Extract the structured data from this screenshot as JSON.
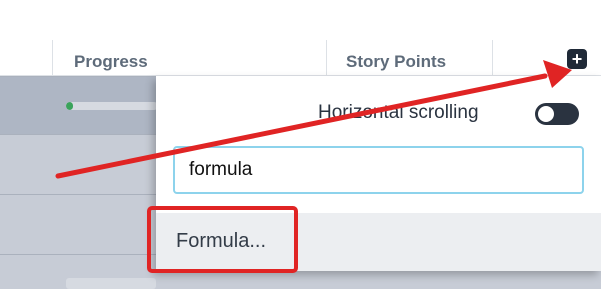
{
  "columns": {
    "progress": "Progress",
    "story_points": "Story Points",
    "add_column_glyph": "+"
  },
  "rows": [
    {
      "progress_value": 0.08
    },
    {},
    {},
    {}
  ],
  "dropdown": {
    "horizontal_scrolling_label": "Horizontal scrolling",
    "horizontal_scrolling_enabled": false,
    "search_value": "formula",
    "option_label": "Formula..."
  },
  "colors": {
    "annotation": "#e02424",
    "progress_fill": "#3aa35b",
    "input_focus_border": "#8dd3ec",
    "toggle_track": "#2a3340"
  },
  "icons": {
    "add_column": "plus-square-icon",
    "annotation_arrow": "arrow-icon"
  }
}
